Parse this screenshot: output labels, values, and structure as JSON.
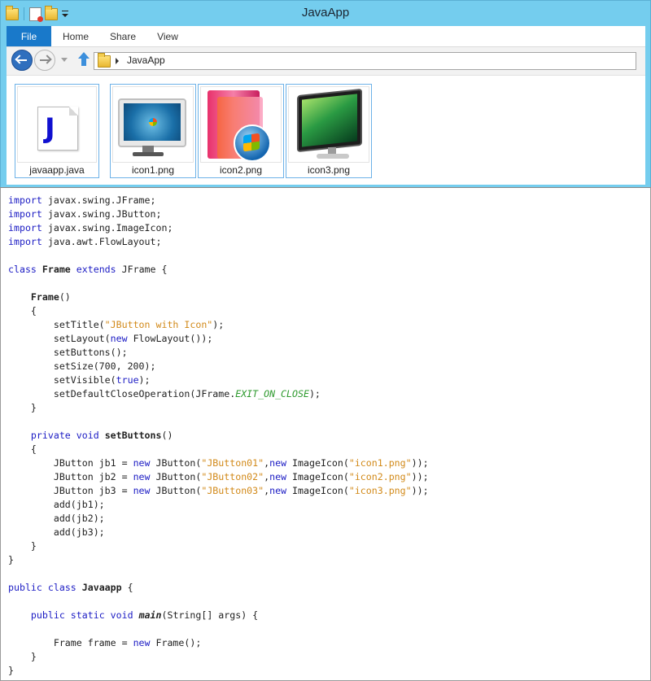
{
  "window": {
    "title": "JavaApp"
  },
  "ribbon": {
    "tabs": [
      "File",
      "Home",
      "Share",
      "View"
    ]
  },
  "address": {
    "path": "JavaApp"
  },
  "files": [
    {
      "name": "javaapp.java",
      "icon": "java-file-icon"
    },
    {
      "name": "icon1.png",
      "icon": "monitor-icon"
    },
    {
      "name": "icon2.png",
      "icon": "windows-folder-icon"
    },
    {
      "name": "icon3.png",
      "icon": "widescreen-monitor-icon"
    }
  ],
  "colors": {
    "keyword": "#1c1cc4",
    "string": "#d28a1a",
    "constant": "#2e9a2e",
    "titlebar": "#74cdee",
    "file_tab": "#1979ca"
  },
  "code": [
    [
      {
        "t": "import",
        "c": "kw"
      },
      {
        "t": " javax.swing.JFrame;"
      }
    ],
    [
      {
        "t": "import",
        "c": "kw"
      },
      {
        "t": " javax.swing.JButton;"
      }
    ],
    [
      {
        "t": "import",
        "c": "kw"
      },
      {
        "t": " javax.swing.ImageIcon;"
      }
    ],
    [
      {
        "t": "import",
        "c": "kw"
      },
      {
        "t": " java.awt.FlowLayout;"
      }
    ],
    [],
    [
      {
        "t": "class",
        "c": "kw"
      },
      {
        "t": " "
      },
      {
        "t": "Frame",
        "c": "bold"
      },
      {
        "t": " "
      },
      {
        "t": "extends",
        "c": "kw"
      },
      {
        "t": " JFrame {"
      }
    ],
    [],
    [
      {
        "t": "    "
      },
      {
        "t": "Frame",
        "c": "bold"
      },
      {
        "t": "()"
      }
    ],
    [
      {
        "t": "    {"
      }
    ],
    [
      {
        "t": "        setTitle("
      },
      {
        "t": "\"JButton with Icon\"",
        "c": "str"
      },
      {
        "t": ");"
      }
    ],
    [
      {
        "t": "        setLayout("
      },
      {
        "t": "new",
        "c": "kw"
      },
      {
        "t": " FlowLayout());"
      }
    ],
    [
      {
        "t": "        setButtons();"
      }
    ],
    [
      {
        "t": "        setSize(700, 200);"
      }
    ],
    [
      {
        "t": "        setVisible("
      },
      {
        "t": "true",
        "c": "kw"
      },
      {
        "t": ");"
      }
    ],
    [
      {
        "t": "        setDefaultCloseOperation(JFrame."
      },
      {
        "t": "EXIT_ON_CLOSE",
        "c": "const"
      },
      {
        "t": ");"
      }
    ],
    [
      {
        "t": "    }"
      }
    ],
    [],
    [
      {
        "t": "    "
      },
      {
        "t": "private",
        "c": "kw"
      },
      {
        "t": " "
      },
      {
        "t": "void",
        "c": "kw"
      },
      {
        "t": " "
      },
      {
        "t": "setButtons",
        "c": "bold"
      },
      {
        "t": "()"
      }
    ],
    [
      {
        "t": "    {"
      }
    ],
    [
      {
        "t": "        JButton jb1 = "
      },
      {
        "t": "new",
        "c": "kw"
      },
      {
        "t": " JButton("
      },
      {
        "t": "\"JButton01\"",
        "c": "str"
      },
      {
        "t": ","
      },
      {
        "t": "new",
        "c": "kw"
      },
      {
        "t": " ImageIcon("
      },
      {
        "t": "\"icon1.png\"",
        "c": "str"
      },
      {
        "t": "));"
      }
    ],
    [
      {
        "t": "        JButton jb2 = "
      },
      {
        "t": "new",
        "c": "kw"
      },
      {
        "t": " JButton("
      },
      {
        "t": "\"JButton02\"",
        "c": "str"
      },
      {
        "t": ","
      },
      {
        "t": "new",
        "c": "kw"
      },
      {
        "t": " ImageIcon("
      },
      {
        "t": "\"icon2.png\"",
        "c": "str"
      },
      {
        "t": "));"
      }
    ],
    [
      {
        "t": "        JButton jb3 = "
      },
      {
        "t": "new",
        "c": "kw"
      },
      {
        "t": " JButton("
      },
      {
        "t": "\"JButton03\"",
        "c": "str"
      },
      {
        "t": ","
      },
      {
        "t": "new",
        "c": "kw"
      },
      {
        "t": " ImageIcon("
      },
      {
        "t": "\"icon3.png\"",
        "c": "str"
      },
      {
        "t": "));"
      }
    ],
    [
      {
        "t": "        add(jb1);"
      }
    ],
    [
      {
        "t": "        add(jb2);"
      }
    ],
    [
      {
        "t": "        add(jb3);"
      }
    ],
    [
      {
        "t": "    }"
      }
    ],
    [
      {
        "t": "}"
      }
    ],
    [],
    [
      {
        "t": "public",
        "c": "kw"
      },
      {
        "t": " "
      },
      {
        "t": "class",
        "c": "kw"
      },
      {
        "t": " "
      },
      {
        "t": "Javaapp",
        "c": "bold"
      },
      {
        "t": " {"
      }
    ],
    [],
    [
      {
        "t": "    "
      },
      {
        "t": "public",
        "c": "kw"
      },
      {
        "t": " "
      },
      {
        "t": "static",
        "c": "kw"
      },
      {
        "t": " "
      },
      {
        "t": "void",
        "c": "kw"
      },
      {
        "t": " "
      },
      {
        "t": "main",
        "c": "bi"
      },
      {
        "t": "(String[] args) {"
      }
    ],
    [],
    [
      {
        "t": "        Frame frame = "
      },
      {
        "t": "new",
        "c": "kw"
      },
      {
        "t": " Frame();"
      }
    ],
    [
      {
        "t": "    }"
      }
    ],
    [
      {
        "t": "}"
      }
    ]
  ]
}
